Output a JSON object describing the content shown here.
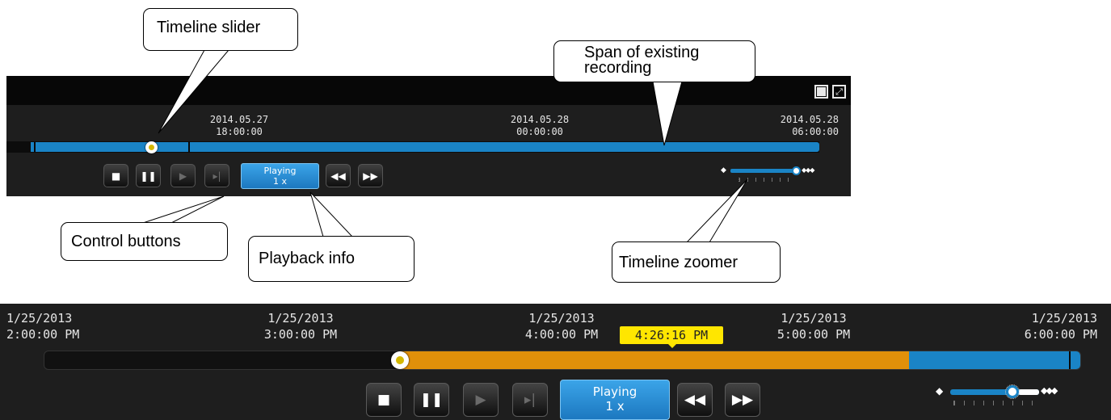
{
  "callouts": {
    "timeline_slider": "Timeline slider",
    "span_line1": "Span of existing",
    "span_line2": "recording",
    "control_buttons": "Control buttons",
    "playback_info": "Playback info",
    "timeline_zoomer": "Timeline zoomer"
  },
  "player1": {
    "ticks": [
      {
        "date": "2014.05.27",
        "time": "18:00:00"
      },
      {
        "date": "2014.05.28",
        "time": "00:00:00"
      },
      {
        "date": "2014.05.28",
        "time": "06:00:00"
      }
    ],
    "playback": {
      "status": "Playing",
      "speed": "1 x"
    }
  },
  "player2": {
    "ticks": [
      {
        "date": "1/25/2013",
        "time": "2:00:00 PM"
      },
      {
        "date": "1/25/2013",
        "time": "3:00:00 PM"
      },
      {
        "date": "1/25/2013",
        "time": "4:00:00 PM"
      },
      {
        "date": "1/25/2013",
        "time": "5:00:00 PM"
      },
      {
        "date": "1/25/2013",
        "time": "6:00:00 PM"
      }
    ],
    "current_time": "4:26:16 PM",
    "playback": {
      "status": "Playing",
      "speed": "1 x"
    }
  },
  "colors": {
    "recording_blue": "#1a84c6",
    "played_orange": "#e0900a",
    "tooltip_yellow": "#ffe600",
    "panel_bg": "#1e1e1e"
  },
  "icons": [
    "single-view-icon",
    "fullscreen-icon",
    "stop-icon",
    "pause-icon",
    "play-icon",
    "step-forward-icon",
    "rewind-icon",
    "fast-forward-icon",
    "zoom-out-icon",
    "zoom-in-icon"
  ]
}
